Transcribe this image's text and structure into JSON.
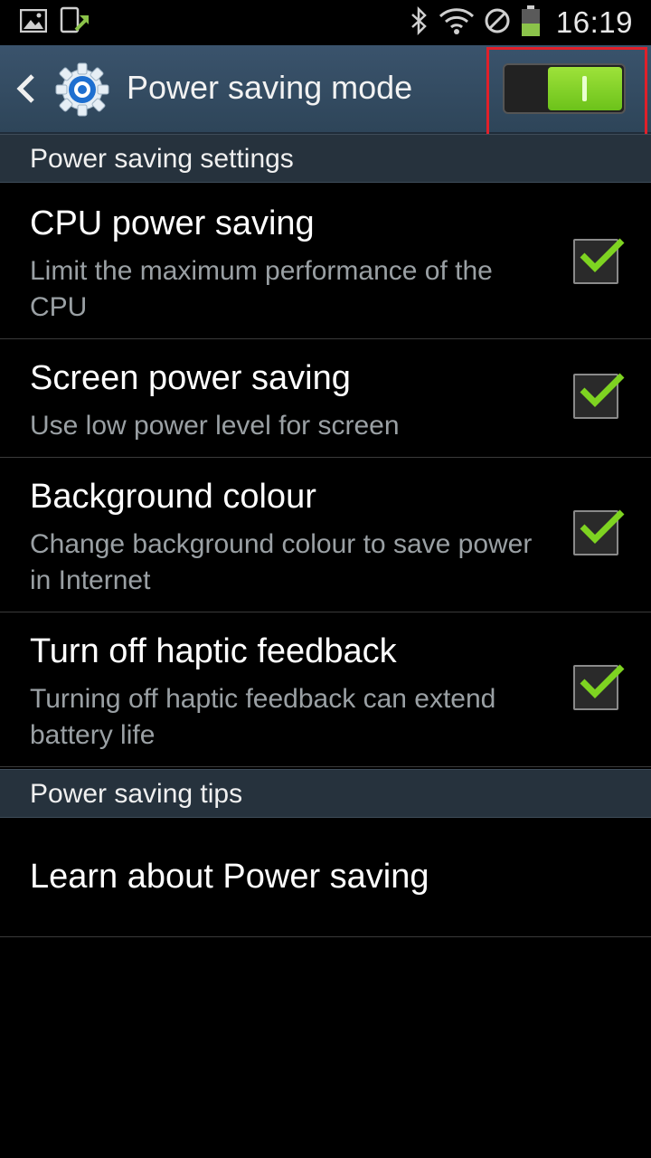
{
  "status_bar": {
    "time": "16:19",
    "icons": [
      "gallery-icon",
      "app-update-icon",
      "bluetooth-icon",
      "wifi-icon",
      "no-sim-icon",
      "battery-icon"
    ]
  },
  "action_bar": {
    "title": "Power saving mode",
    "toggle_on": true,
    "accent_color": "#7ed321"
  },
  "sections": {
    "settings_header": "Power saving settings",
    "tips_header": "Power saving tips"
  },
  "settings": [
    {
      "title": "CPU power saving",
      "summary": "Limit the maximum performance of the CPU",
      "checked": true
    },
    {
      "title": "Screen power saving",
      "summary": "Use low power level for screen",
      "checked": true
    },
    {
      "title": "Background colour",
      "summary": "Change background colour to save power in Internet",
      "checked": true
    },
    {
      "title": "Turn off haptic feedback",
      "summary": "Turning off haptic feedback can extend battery life",
      "checked": true
    }
  ],
  "tips": {
    "learn_label": "Learn about Power saving"
  }
}
